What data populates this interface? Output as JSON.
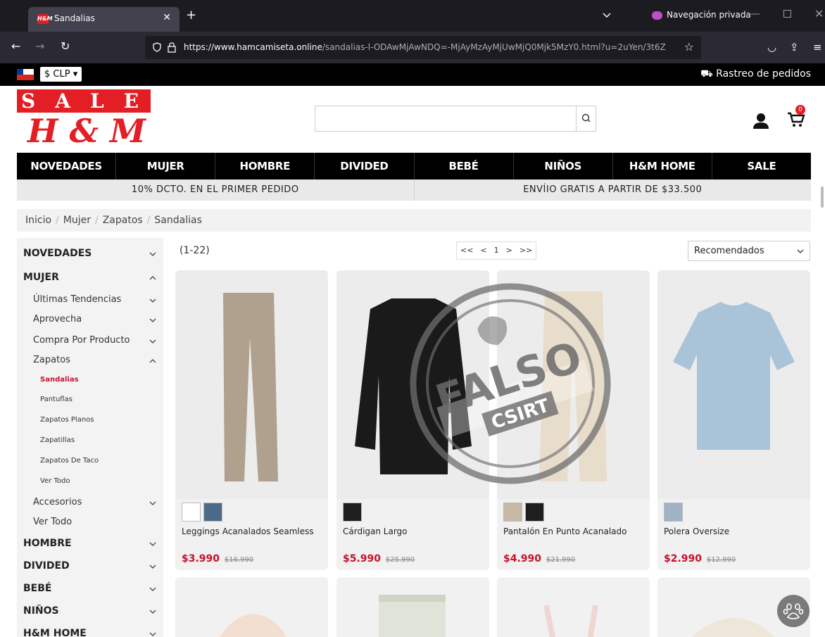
{
  "browser": {
    "tab_title": "Sandalias",
    "tab_favicon_text": "H&M",
    "private_label": "Navegación privada",
    "url_domain": "https://www.hamcamiseta.online",
    "url_path": "/sandalias-l-ODAwMjAwNDQ=-MjAyMzAyMjUwMjQ0Mjk5MzY0.html?u=2uYen/3t6Z"
  },
  "site": {
    "currency": "$ CLP",
    "tracking_label": "Rastreo de pedidos",
    "logo_sale": "SALE",
    "logo_hm": "H & M",
    "cart_count": "0",
    "search_placeholder": ""
  },
  "menu": [
    "NOVEDADES",
    "MUJER",
    "HOMBRE",
    "DIVIDED",
    "BEBÉ",
    "NIÑOS",
    "H&M HOME",
    "SALE"
  ],
  "promos": [
    "10% DCTO. EN EL PRIMER PEDIDO",
    "ENVÍIO GRATIS A PARTIR DE $33.500"
  ],
  "breadcrumb": [
    "Inicio",
    "Mujer",
    "Zapatos",
    "Sandalias"
  ],
  "sidebar": [
    {
      "label": "NOVEDADES",
      "level": 0,
      "chevron": "down"
    },
    {
      "label": "MUJER",
      "level": 0,
      "chevron": "up"
    },
    {
      "label": "Últimas Tendencias",
      "level": 1,
      "chevron": "down"
    },
    {
      "label": "Aprovecha",
      "level": 1,
      "chevron": "down"
    },
    {
      "label": "Compra Por Producto",
      "level": 1,
      "chevron": "down"
    },
    {
      "label": "Zapatos",
      "level": 1,
      "chevron": "up"
    },
    {
      "label": "Sandalias",
      "level": 2,
      "active": true
    },
    {
      "label": "Pantuflas",
      "level": 2
    },
    {
      "label": "Zapatos Planos",
      "level": 2
    },
    {
      "label": "Zapatillas",
      "level": 2
    },
    {
      "label": "Zapatos De Taco",
      "level": 2
    },
    {
      "label": "Ver Todo",
      "level": 2
    },
    {
      "label": "Accesorios",
      "level": 1,
      "chevron": "down"
    },
    {
      "label": "Ver Todo",
      "level": 1
    },
    {
      "label": "HOMBRE",
      "level": 0,
      "chevron": "down"
    },
    {
      "label": "DIVIDED",
      "level": 0,
      "chevron": "down"
    },
    {
      "label": "BEBÉ",
      "level": 0,
      "chevron": "down"
    },
    {
      "label": "NIÑOS",
      "level": 0,
      "chevron": "down"
    },
    {
      "label": "H&M HOME",
      "level": 0,
      "chevron": "down"
    }
  ],
  "results": {
    "count": "(1-22)",
    "pager": [
      "<<",
      "<",
      "1",
      ">",
      ">>"
    ],
    "sort": "Recomendados"
  },
  "products": [
    {
      "name": "Leggings Acanalados Seamless",
      "price": "$3.990",
      "old_price": "$16.990",
      "swatches": [
        "#ffffff",
        "#4b6a8a"
      ]
    },
    {
      "name": "Cárdigan Largo",
      "price": "$5.990",
      "old_price": "$25.990",
      "swatches": [
        "#1e1e1e"
      ]
    },
    {
      "name": "Pantalón En Punto Acanalado",
      "price": "$4.990",
      "old_price": "$21.990",
      "swatches": [
        "#c8b9a6",
        "#1e1e1e"
      ]
    },
    {
      "name": "Polera Oversize",
      "price": "$2.990",
      "old_price": "$12.990",
      "swatches": [
        "#9fb2c6"
      ]
    }
  ],
  "stamp": {
    "top": "FALSO",
    "bottom": "CSIRT"
  },
  "colors": {
    "brand_red": "#e31e24",
    "price_red": "#c8102e",
    "menu_bg": "#000000"
  }
}
